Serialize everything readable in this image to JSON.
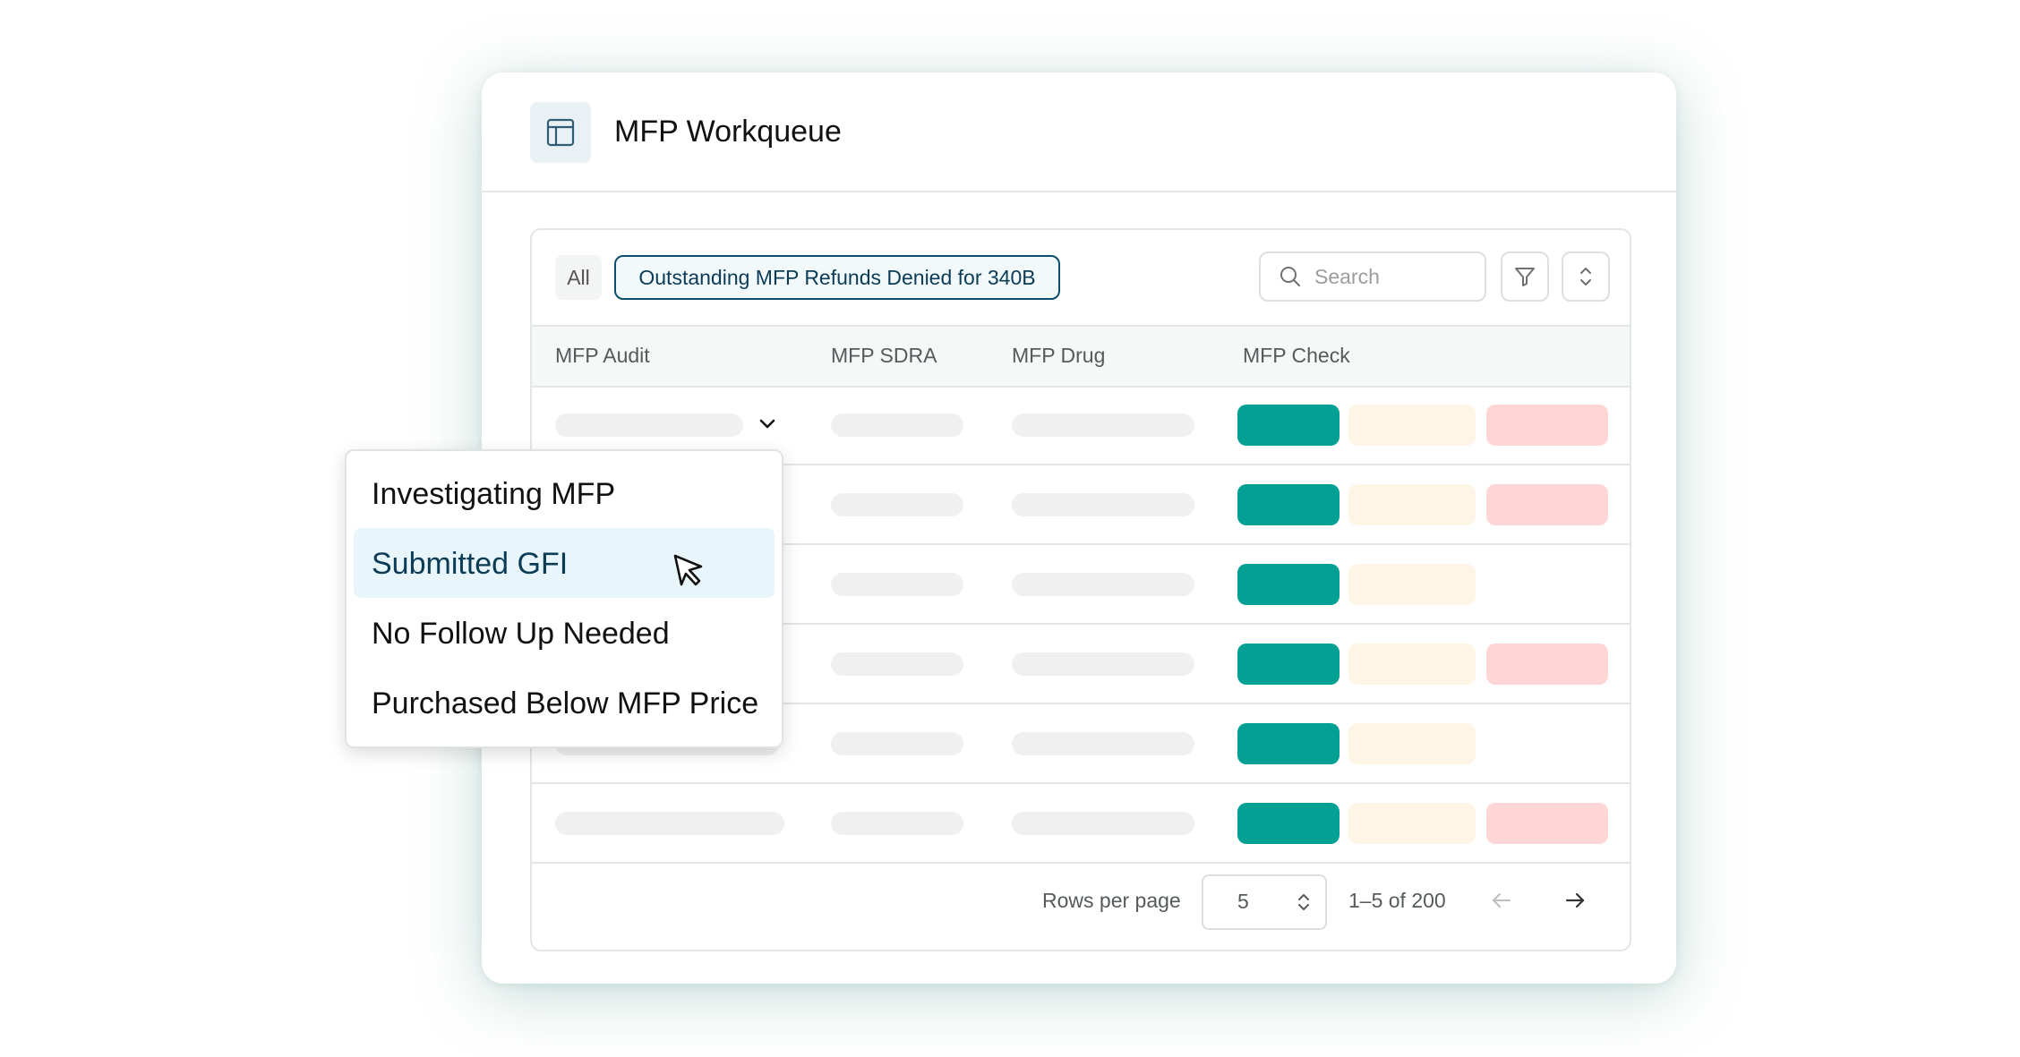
{
  "window": {
    "title": "MFP Workqueue",
    "icon": "table-icon"
  },
  "toolbar": {
    "all_label": "All",
    "active_filter_label": "Outstanding MFP Refunds Denied for 340B",
    "search_placeholder": "Search",
    "filter_icon": "filter-icon",
    "sort_icon": "sort-icon"
  },
  "table": {
    "columns": [
      "MFP Audit",
      "MFP SDRA",
      "MFP Drug",
      "MFP Check"
    ],
    "rows": [
      {
        "status_pills": [
          "green",
          "cream",
          "pink"
        ],
        "has_dropdown": true
      },
      {
        "status_pills": [
          "green",
          "cream",
          "pink"
        ]
      },
      {
        "status_pills": [
          "green",
          "cream"
        ]
      },
      {
        "status_pills": [
          "green",
          "cream",
          "pink"
        ]
      },
      {
        "status_pills": [
          "green",
          "cream"
        ]
      },
      {
        "status_pills": [
          "green",
          "cream",
          "pink"
        ]
      }
    ]
  },
  "dropdown": {
    "items": [
      {
        "label": "Investigating MFP",
        "selected": false
      },
      {
        "label": "Submitted GFI",
        "selected": true
      },
      {
        "label": "No Follow Up Needed",
        "selected": false
      },
      {
        "label": "Purchased Below MFP Price",
        "selected": false
      }
    ]
  },
  "pagination": {
    "rows_per_page_label": "Rows per page",
    "rows_per_page_value": "5",
    "range_text": "1–5 of 200",
    "prev_icon": "arrow-left-icon",
    "next_icon": "arrow-right-icon"
  },
  "colors": {
    "green": "#03a093",
    "cream": "#fff5e6",
    "pink": "#ffd6d6",
    "accent": "#0b4f6c",
    "selected_bg": "#e8f6fb"
  }
}
